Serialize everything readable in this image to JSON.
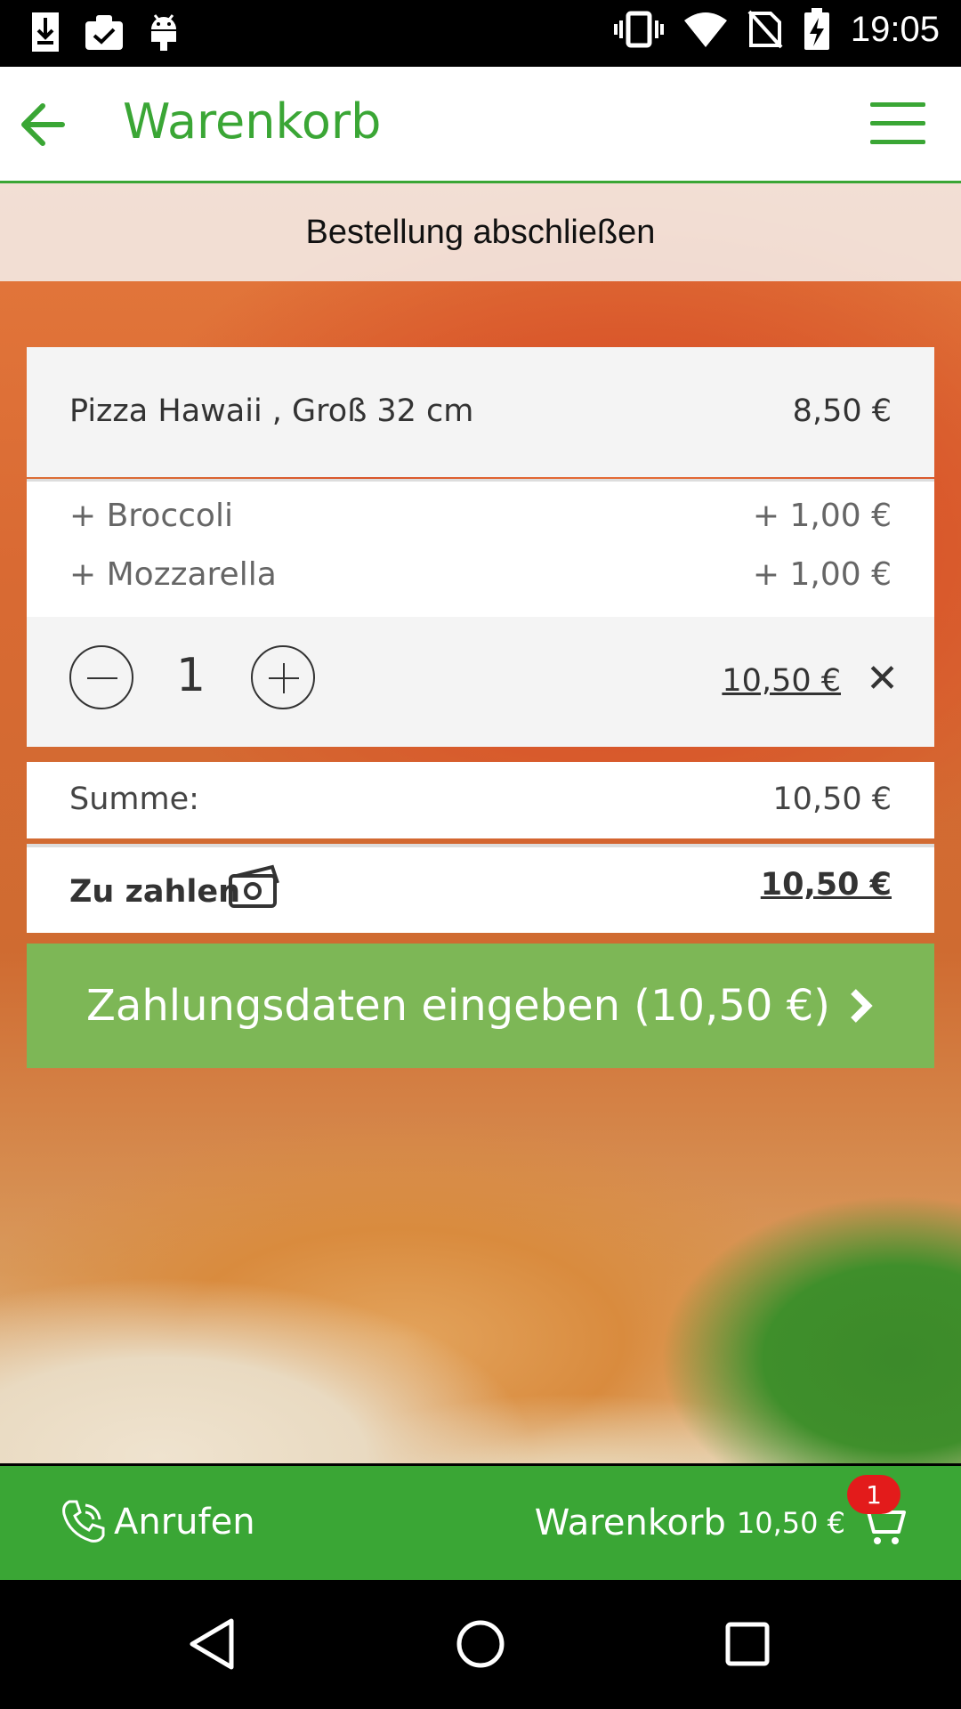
{
  "status_bar": {
    "time": "19:05",
    "left_icons": [
      "download-icon",
      "clipboard-check-icon",
      "android-icon"
    ],
    "right_icons": [
      "vibrate-icon",
      "wifi-icon",
      "no-sim-icon",
      "battery-charging-icon"
    ]
  },
  "app_bar": {
    "title": "Warenkorb",
    "back_icon": "arrow-left-icon",
    "menu_icon": "hamburger-menu-icon",
    "accent_color": "#3aa635"
  },
  "checkout": {
    "heading": "Bestellung abschließen"
  },
  "cart_item": {
    "name": "Pizza Hawaii , Groß 32 cm",
    "price": "8,50 €",
    "extras": [
      {
        "label": "+ Broccoli",
        "price": "+ 1,00 €"
      },
      {
        "label": "+ Mozzarella",
        "price": "+ 1,00 €"
      }
    ],
    "quantity": "1",
    "line_total": "10,50 €",
    "remove_symbol": "✕"
  },
  "totals": {
    "sum_label": "Summe:",
    "sum_value": "10,50 €",
    "to_pay_label": "Zu zahlen",
    "to_pay_value": "10,50 €",
    "cash_icon": "cash-icon"
  },
  "pay_button": {
    "label": "Zahlungsdaten eingeben (10,50 €)",
    "color": "#7db756"
  },
  "bottom_bar": {
    "call_label": "Anrufen",
    "cart_label": "Warenkorb",
    "cart_amount": "10,50 €",
    "cart_badge": "1",
    "badge_color": "#e31b1b"
  },
  "nav_bar": {
    "icons": [
      "back-triangle-icon",
      "home-circle-icon",
      "recents-square-icon"
    ]
  }
}
